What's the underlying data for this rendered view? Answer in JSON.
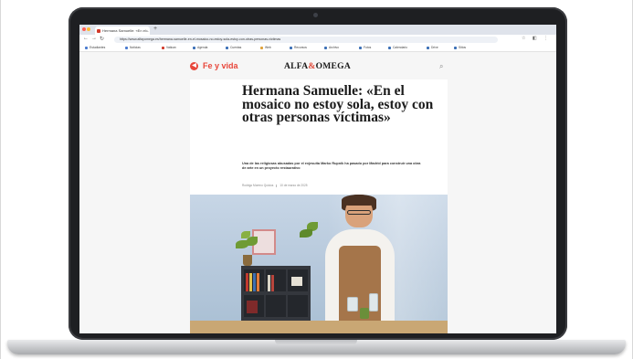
{
  "browser": {
    "tab_title": "Hermana Samuelle: «En el...",
    "new_tab": "+",
    "url": "https://www.alfayomega.es/hermana-samuelle-en-el-mosaico-no-estoy-sola-estoy-con-otras-personas-victimas",
    "bookmarks": [
      "Estudiantes",
      "Noticias",
      "Vatican",
      "Agenda",
      "Cuentas",
      "Web",
      "Recursos",
      "Archivo",
      "Fotos",
      "Calendario",
      "Drive",
      "Sitios"
    ]
  },
  "site": {
    "section": "Fe y vida",
    "logo_left": "ALFA",
    "logo_amp": "&",
    "logo_right": "OMEGA"
  },
  "article": {
    "headline": "Hermana Samuelle: «En el mosaico no estoy sola, estoy con otras personas víctimas»",
    "standfirst": "Una de las religiosas abusadas por el exjesuita Marko Rupnik ha pasado por Madrid para construir una obra de arte en un proyecto restaurativo",
    "author": "Rodrigo Moreno Quicios",
    "date": "10 de marzo de 2025"
  },
  "colors": {
    "accent": "#e8473b",
    "bezel": "#1e1f22"
  }
}
